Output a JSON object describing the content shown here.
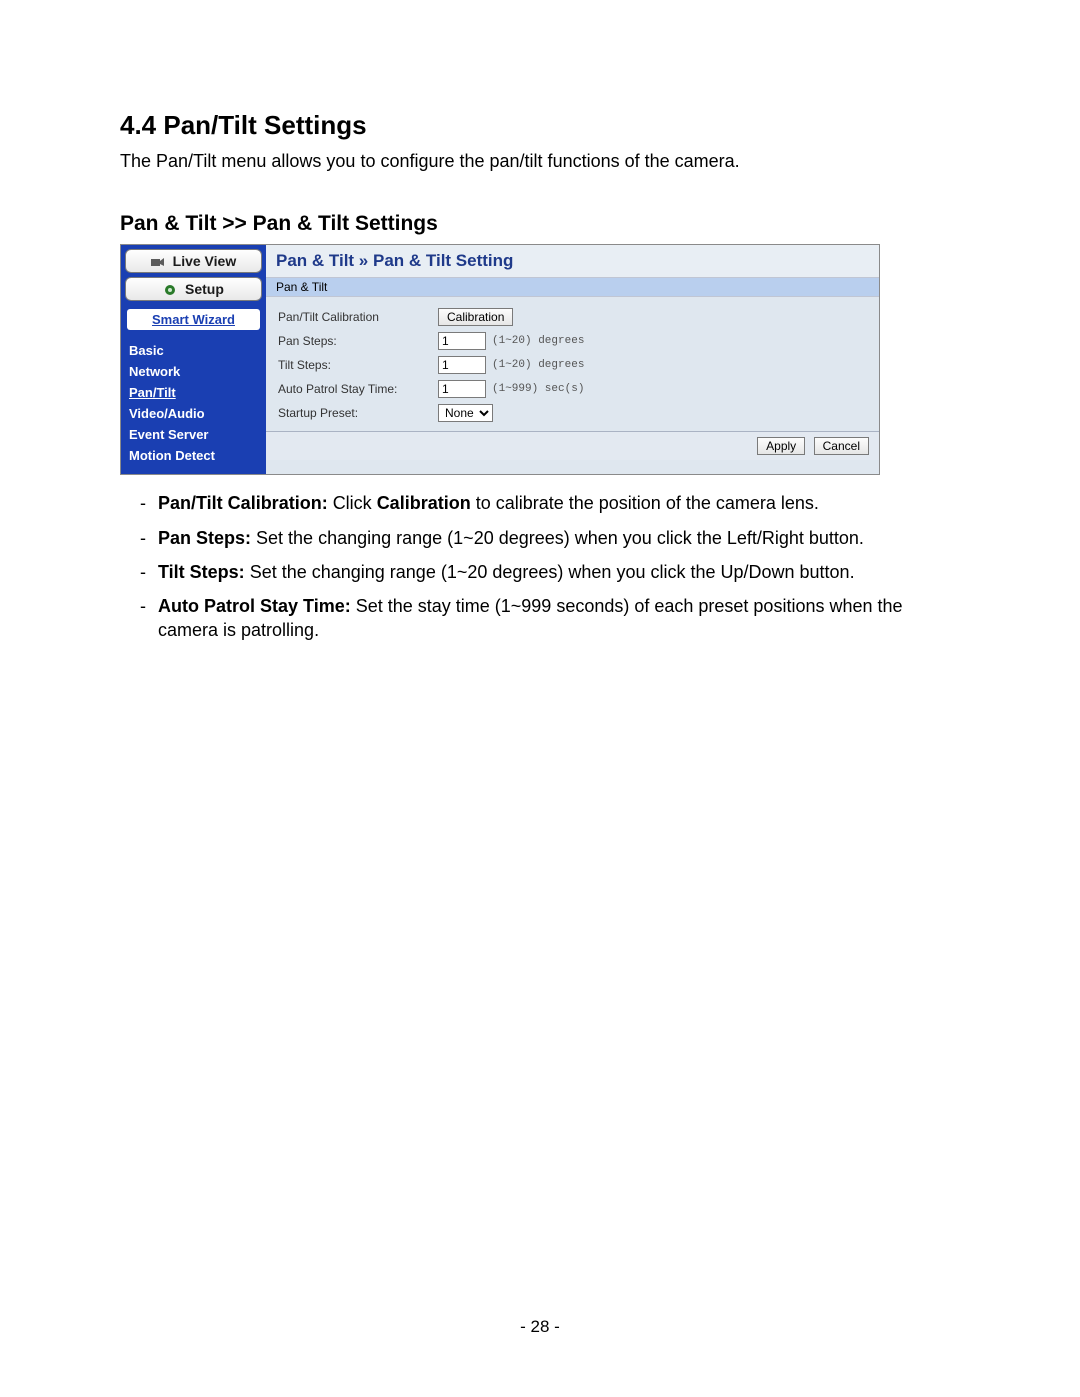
{
  "doc": {
    "section_title": "4.4  Pan/Tilt Settings",
    "intro": "The Pan/Tilt menu allows you to configure the pan/tilt functions of the camera.",
    "subheading": "Pan & Tilt >> Pan & Tilt Settings",
    "page_number": "- 28 -"
  },
  "sidebar": {
    "live_view": "Live View",
    "setup": "Setup",
    "smart_wizard": "Smart Wizard",
    "items": [
      {
        "label": "Basic",
        "active": false
      },
      {
        "label": "Network",
        "active": false
      },
      {
        "label": "Pan/Tilt",
        "active": true
      },
      {
        "label": "Video/Audio",
        "active": false
      },
      {
        "label": "Event Server",
        "active": false
      },
      {
        "label": "Motion Detect",
        "active": false
      }
    ]
  },
  "content": {
    "breadcrumb": "Pan & Tilt » Pan & Tilt Setting",
    "band": "Pan & Tilt",
    "rows": {
      "calibration_label": "Pan/Tilt Calibration",
      "calibration_button": "Calibration",
      "pan_steps_label": "Pan Steps:",
      "pan_steps_value": "1",
      "pan_steps_hint": "(1~20) degrees",
      "tilt_steps_label": "Tilt Steps:",
      "tilt_steps_value": "1",
      "tilt_steps_hint": "(1~20) degrees",
      "auto_patrol_label": "Auto Patrol Stay Time:",
      "auto_patrol_value": "1",
      "auto_patrol_hint": "(1~999) sec(s)",
      "startup_preset_label": "Startup Preset:",
      "startup_preset_value": "None"
    },
    "actions": {
      "apply": "Apply",
      "cancel": "Cancel"
    }
  },
  "definitions": {
    "d0_term": "Pan/Tilt Calibration: ",
    "d0_pre": "Click ",
    "d0_bold": "Calibration",
    "d0_post": " to calibrate the position of the camera lens.",
    "d1_term": "Pan Steps: ",
    "d1_text": "Set the changing range (1~20 degrees) when you click the Left/Right button.",
    "d2_term": "Tilt Steps: ",
    "d2_text": "Set the changing range (1~20 degrees) when you click the Up/Down button.",
    "d3_term": "Auto Patrol Stay Time: ",
    "d3_text": "Set the stay time (1~999 seconds) of each preset positions when the camera is patrolling."
  }
}
